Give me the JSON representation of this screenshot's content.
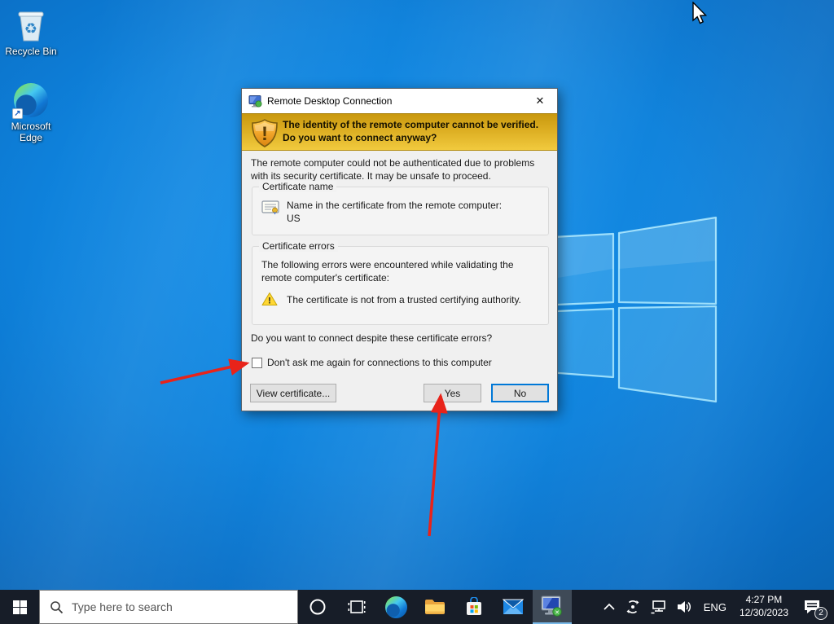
{
  "desktop": {
    "icons": [
      {
        "name": "recycle-bin",
        "label": "Recycle Bin"
      },
      {
        "name": "microsoft-edge",
        "label": "Microsoft Edge"
      }
    ]
  },
  "dialog": {
    "title": "Remote Desktop Connection",
    "close_glyph": "✕",
    "banner_text": "The identity of the remote computer cannot be verified. Do you want to connect anyway?",
    "intro": "The remote computer could not be authenticated due to problems with its security certificate. It may be unsafe to proceed.",
    "certificate_name": {
      "group_title": "Certificate name",
      "description": "Name in the certificate from the remote computer:",
      "value": "US"
    },
    "certificate_errors": {
      "group_title": "Certificate errors",
      "description": "The following errors were encountered while validating the remote computer's certificate:",
      "error": "The certificate is not from a trusted certifying authority."
    },
    "question": "Do you want to connect despite these certificate errors?",
    "checkbox": {
      "label": "Don't ask me again for connections to this computer",
      "checked": false
    },
    "buttons": {
      "view_certificate": "View certificate...",
      "yes": "Yes",
      "no": "No"
    }
  },
  "taskbar": {
    "search_placeholder": "Type here to search",
    "language": "ENG",
    "clock": {
      "time": "4:27 PM",
      "date": "12/30/2023"
    },
    "notifications_badge": "2"
  },
  "colors": {
    "desktop_blue": "#0e82dc",
    "taskbar_dark": "#171d28",
    "banner_gold_top": "#c8980e",
    "banner_gold_bottom": "#f1ca3e",
    "focus_blue": "#0078d7",
    "annotation_red": "#e8231a",
    "rdp_underline": "#79b9e8"
  }
}
